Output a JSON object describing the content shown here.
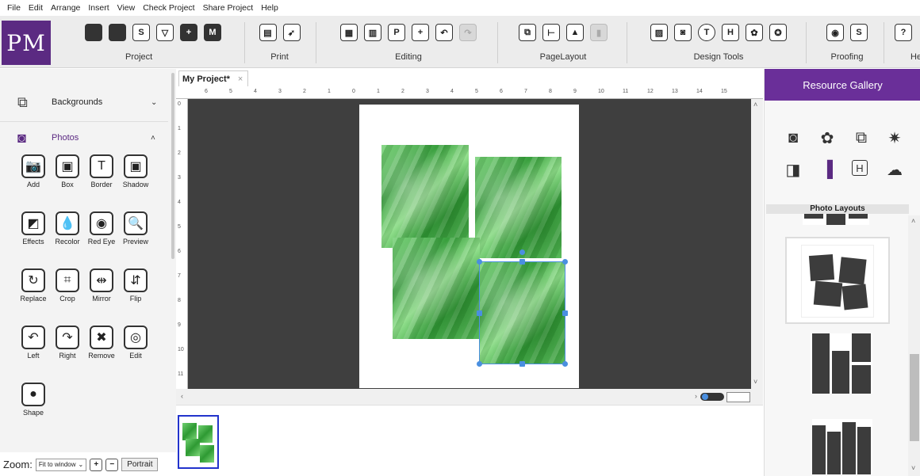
{
  "menu": [
    "File",
    "Edit",
    "Arrange",
    "Insert",
    "View",
    "Check Project",
    "Share Project",
    "Help"
  ],
  "logo": "PM",
  "ribbon": {
    "groups": [
      {
        "label": "Project",
        "buttons": [
          "new-project-icon",
          "open-folder-icon",
          "save-icon",
          "save-as-icon",
          "add-page-icon",
          "master-page-icon"
        ]
      },
      {
        "label": "Print",
        "buttons": [
          "printer-icon",
          "print-service-icon"
        ]
      },
      {
        "label": "Editing",
        "buttons": [
          "paste-icon",
          "copy-icon",
          "text-box-icon",
          "add-icon",
          "undo-icon",
          "redo-icon"
        ]
      },
      {
        "label": "PageLayout",
        "buttons": [
          "layer-icon",
          "align-icon",
          "page-setup-icon",
          "page-background-icon"
        ]
      },
      {
        "label": "Design Tools",
        "buttons": [
          "image-icon",
          "camera-icon",
          "clipart-icon",
          "heading-icon",
          "flower-icon",
          "badge-icon"
        ]
      },
      {
        "label": "Proofing",
        "buttons": [
          "preview-icon",
          "spellcheck-icon"
        ]
      },
      {
        "label": "He",
        "buttons": [
          "help-icon"
        ]
      }
    ],
    "glyphs": {
      "save": "S",
      "page": "+",
      "master": "M",
      "text": "P",
      "add": "+",
      "heading": "H",
      "clipart": "T",
      "spell": "S"
    }
  },
  "left_panel": {
    "sections": [
      {
        "title": "Backgrounds",
        "icon": "backgrounds-icon",
        "chevron": "⌄"
      },
      {
        "title": "Photos",
        "icon": "photos-icon",
        "chevron": "˄"
      }
    ],
    "tools": [
      {
        "label": "Add",
        "icon": "camera-icon",
        "glyph": "📷"
      },
      {
        "label": "Box",
        "icon": "box-icon",
        "glyph": "▣"
      },
      {
        "label": "Border",
        "icon": "border-icon",
        "glyph": "T"
      },
      {
        "label": "Shadow",
        "icon": "shadow-icon",
        "glyph": "▣"
      },
      {
        "label": "Effects",
        "icon": "effects-icon",
        "glyph": "◩"
      },
      {
        "label": "Recolor",
        "icon": "recolor-icon",
        "glyph": "💧"
      },
      {
        "label": "Red Eye",
        "icon": "red-eye-icon",
        "glyph": "◉"
      },
      {
        "label": "Preview",
        "icon": "preview-icon",
        "glyph": "🔍"
      },
      {
        "label": "Replace",
        "icon": "replace-icon",
        "glyph": "↻"
      },
      {
        "label": "Crop",
        "icon": "crop-icon",
        "glyph": "⌗"
      },
      {
        "label": "Mirror",
        "icon": "mirror-icon",
        "glyph": "⇹"
      },
      {
        "label": "Flip",
        "icon": "flip-icon",
        "glyph": "⇵"
      },
      {
        "label": "Left",
        "icon": "rotate-left-icon",
        "glyph": "↶"
      },
      {
        "label": "Right",
        "icon": "rotate-right-icon",
        "glyph": "↷"
      },
      {
        "label": "Remove",
        "icon": "remove-icon",
        "glyph": "✖"
      },
      {
        "label": "Edit",
        "icon": "edit-icon",
        "glyph": "◎"
      },
      {
        "label": "Shape",
        "icon": "shape-icon",
        "glyph": "●"
      }
    ]
  },
  "zoom": {
    "label": "Zoom:",
    "value": "Fit to window",
    "zoom_in": "+",
    "zoom_out": "−",
    "orientation": "Portrait"
  },
  "document_tab": {
    "title": "My Project*",
    "close": "×"
  },
  "ruler": {
    "h": [
      "6",
      "5",
      "4",
      "3",
      "2",
      "1",
      "0",
      "1",
      "2",
      "3",
      "4",
      "5",
      "6",
      "7",
      "8",
      "9",
      "10",
      "11",
      "12",
      "13",
      "14",
      "15"
    ],
    "v": [
      "0",
      "1",
      "2",
      "3",
      "4",
      "5",
      "6",
      "7",
      "8",
      "9",
      "10",
      "11"
    ]
  },
  "right_panel": {
    "title": "Resource Gallery",
    "icons": [
      "photo-icon",
      "lotus-icon",
      "shapes-icon",
      "star-burst-icon",
      "layout-icon",
      "layouts-active-icon",
      "heading-icon",
      "web-cloud-icon"
    ],
    "icon_glyphs": [
      "◙",
      "✿",
      "⧉",
      "✷",
      "◨",
      "▐",
      "H",
      "☁"
    ],
    "section": "Photo Layouts"
  },
  "colors": {
    "brand": "#5b2a82",
    "gallery": "#6a2f99",
    "selection": "#4a8fe0",
    "canvas_bg": "#3f3f3f"
  }
}
